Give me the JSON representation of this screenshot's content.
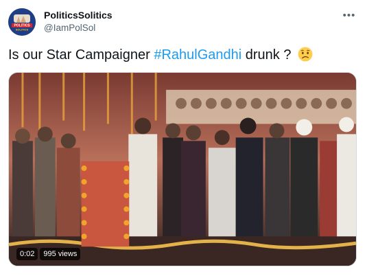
{
  "author": {
    "display_name": "PoliticsSolitics",
    "handle": "@IamPolSol",
    "avatar_logo_text": [
      "POLITICS",
      "SOLITICS"
    ]
  },
  "tweet": {
    "text_before": "Is our Star Campaigner ",
    "hashtag": "#RahulGandhi",
    "text_after": " drunk ?",
    "emoji": "worried-face-emoji"
  },
  "video": {
    "duration": "0:02",
    "views": "995 views"
  },
  "more_menu_icon": "ellipsis-icon",
  "colors": {
    "hashtag": "#1d9bf0",
    "secondary_text": "#536471",
    "avatar_bg": "#1f3e86"
  }
}
